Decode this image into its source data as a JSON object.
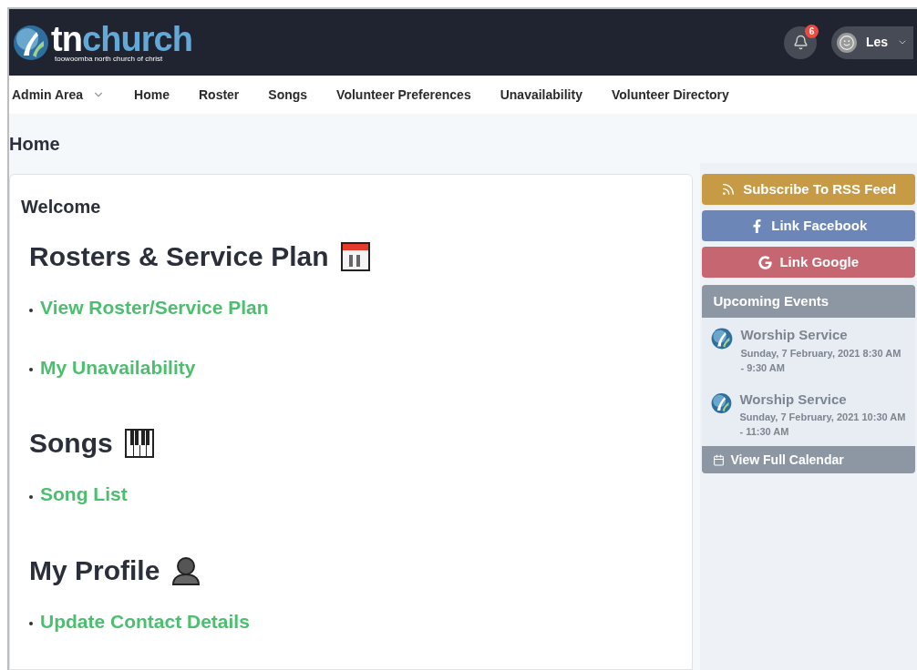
{
  "header": {
    "logo_main": "tn",
    "logo_accent": "church",
    "logo_tagline": "toowoomba north church of christ",
    "notifications": "6",
    "user": "Les"
  },
  "nav": [
    {
      "label": "Admin Area",
      "kind": "dropdown"
    },
    {
      "label": "Home",
      "kind": "link"
    },
    {
      "label": "Roster",
      "kind": "link"
    },
    {
      "label": "Songs",
      "kind": "link"
    },
    {
      "label": "Volunteer Preferences",
      "kind": "link"
    },
    {
      "label": "Unavailability",
      "kind": "link"
    },
    {
      "label": "Volunteer Directory",
      "kind": "link"
    }
  ],
  "page_title": "Home",
  "card": {
    "title": "Welcome",
    "sections": [
      {
        "heading": "Rosters & Service Plan",
        "kind": "calendar",
        "links": [
          "View Roster/Service Plan",
          "My Unavailability"
        ]
      },
      {
        "heading": "Songs",
        "kind": "piano",
        "links": [
          "Song List"
        ]
      },
      {
        "heading": "My Profile",
        "kind": "person",
        "links": [
          "Update Contact Details"
        ]
      }
    ]
  },
  "sidebar": {
    "buttons": [
      {
        "label": "Subscribe To RSS Feed",
        "kind": "rss"
      },
      {
        "label": "Link Facebook",
        "kind": "facebook"
      },
      {
        "label": "Link Google",
        "kind": "google"
      }
    ],
    "events_title": "Upcoming Events",
    "events": [
      {
        "title": "Worship Service",
        "when": "Sunday, 7 February, 2021 8:30 AM - 9:30 AM"
      },
      {
        "title": "Worship Service",
        "when": "Sunday, 7 February, 2021 10:30 AM - 11:30 AM"
      }
    ],
    "calendar_link": "View Full Calendar"
  }
}
